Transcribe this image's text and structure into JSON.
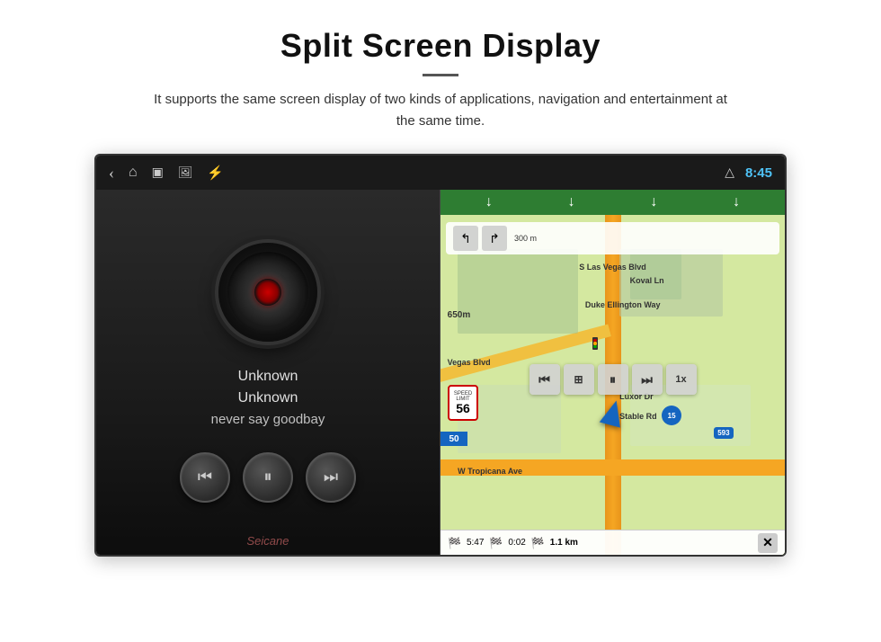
{
  "page": {
    "title": "Split Screen Display",
    "divider": "—",
    "subtitle": "It supports the same screen display of two kinds of applications, navigation and entertainment at the same time."
  },
  "statusBar": {
    "time": "8:45",
    "icons": {
      "back": "‹",
      "home": "⌂",
      "recents": "▣",
      "gallery": "🖼",
      "usb": "⚡",
      "eject": "△"
    }
  },
  "mediaPlayer": {
    "trackTitle": "Unknown",
    "trackArtist": "Unknown",
    "trackSong": "never say goodbay",
    "controls": {
      "prev": "⏮",
      "play": "⏸",
      "next": "⏭"
    },
    "watermark": "Seicane"
  },
  "navigation": {
    "topBarArrows": [
      "↓",
      "↓",
      "↓",
      "↓"
    ],
    "roadName": "S Las Vegas Blvd",
    "instruction": {
      "turnLeft": "↰",
      "turnRight": "↱",
      "distance": "300 m"
    },
    "distance650": "650m",
    "controls": {
      "prev": "⏮",
      "grid": "⊞",
      "pause": "⏸",
      "next": "⏭",
      "speed": "1x"
    },
    "speedSign": {
      "topText": "SPEED LIMIT",
      "number": "56"
    },
    "bottomBar": {
      "time": "5:47",
      "elapsed": "0:02",
      "distance": "1.1 km"
    },
    "streets": {
      "kovalLn": "Koval Ln",
      "dukeEllington": "Duke Ellington Way",
      "luxorDr": "Luxor Dr",
      "stableRd": "Stable Rd",
      "wTropicana": "W Tropicana Ave",
      "vegasBlvd": "Vegas Blvd"
    },
    "badges": {
      "road15": "15",
      "road50": "50",
      "road593": "593"
    }
  }
}
